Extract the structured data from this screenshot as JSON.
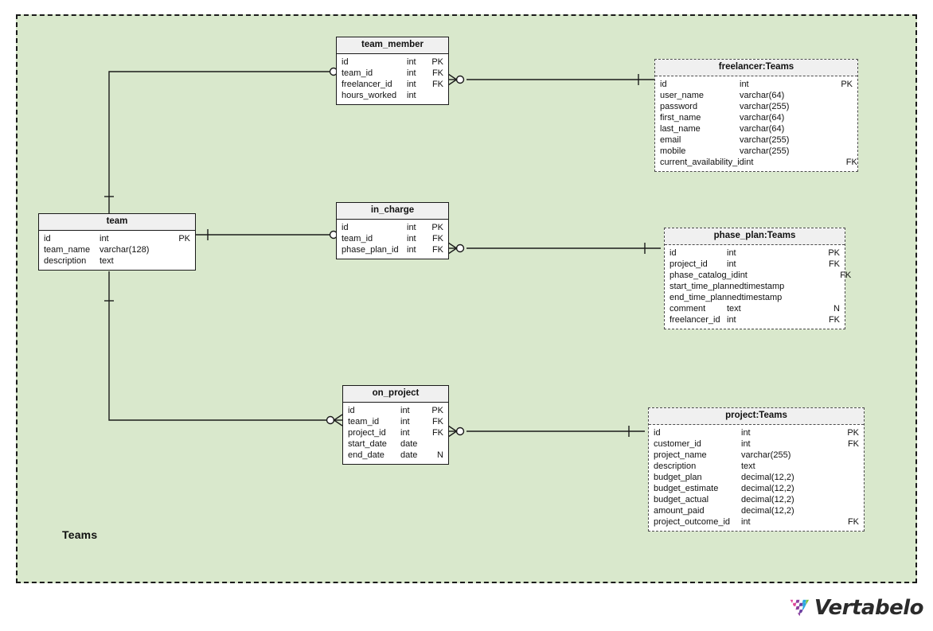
{
  "diagram": {
    "subject_area_label": "Teams",
    "background_color": "#d9e8cc",
    "border_style": "dashed",
    "entity_header_color": "#f0f0f0"
  },
  "entities": {
    "team_member": {
      "title": "team_member",
      "attributes": [
        {
          "name": "id",
          "type": "int",
          "key": "PK"
        },
        {
          "name": "team_id",
          "type": "int",
          "key": "FK"
        },
        {
          "name": "freelancer_id",
          "type": "int",
          "key": "FK"
        },
        {
          "name": "hours_worked",
          "type": "int",
          "key": ""
        }
      ]
    },
    "freelancer": {
      "title": "freelancer:Teams",
      "attributes": [
        {
          "name": "id",
          "type": "int",
          "key": "PK"
        },
        {
          "name": "user_name",
          "type": "varchar(64)",
          "key": ""
        },
        {
          "name": "password",
          "type": "varchar(255)",
          "key": ""
        },
        {
          "name": "first_name",
          "type": "varchar(64)",
          "key": ""
        },
        {
          "name": "last_name",
          "type": "varchar(64)",
          "key": ""
        },
        {
          "name": "email",
          "type": "varchar(255)",
          "key": ""
        },
        {
          "name": "mobile",
          "type": "varchar(255)",
          "key": ""
        },
        {
          "name": "current_availability_id",
          "type": "int",
          "key": "FK"
        }
      ]
    },
    "team": {
      "title": "team",
      "attributes": [
        {
          "name": "id",
          "type": "int",
          "key": "PK"
        },
        {
          "name": "team_name",
          "type": "varchar(128)",
          "key": ""
        },
        {
          "name": "description",
          "type": "text",
          "key": ""
        }
      ]
    },
    "in_charge": {
      "title": "in_charge",
      "attributes": [
        {
          "name": "id",
          "type": "int",
          "key": "PK"
        },
        {
          "name": "team_id",
          "type": "int",
          "key": "FK"
        },
        {
          "name": "phase_plan_id",
          "type": "int",
          "key": "FK"
        }
      ]
    },
    "phase_plan": {
      "title": "phase_plan:Teams",
      "attributes": [
        {
          "name": "id",
          "type": "int",
          "key": "PK"
        },
        {
          "name": "project_id",
          "type": "int",
          "key": "FK"
        },
        {
          "name": "phase_catalog_id",
          "type": "int",
          "key": "FK"
        },
        {
          "name": "start_time_planned",
          "type": "timestamp",
          "key": ""
        },
        {
          "name": "end_time_planned",
          "type": "timestamp",
          "key": ""
        },
        {
          "name": "comment",
          "type": "text",
          "key": "N"
        },
        {
          "name": "freelancer_id",
          "type": "int",
          "key": "FK"
        }
      ]
    },
    "on_project": {
      "title": "on_project",
      "attributes": [
        {
          "name": "id",
          "type": "int",
          "key": "PK"
        },
        {
          "name": "team_id",
          "type": "int",
          "key": "FK"
        },
        {
          "name": "project_id",
          "type": "int",
          "key": "FK"
        },
        {
          "name": "start_date",
          "type": "date",
          "key": ""
        },
        {
          "name": "end_date",
          "type": "date",
          "key": "N"
        }
      ]
    },
    "project": {
      "title": "project:Teams",
      "attributes": [
        {
          "name": "id",
          "type": "int",
          "key": "PK"
        },
        {
          "name": "customer_id",
          "type": "int",
          "key": "FK"
        },
        {
          "name": "project_name",
          "type": "varchar(255)",
          "key": ""
        },
        {
          "name": "description",
          "type": "text",
          "key": ""
        },
        {
          "name": "budget_plan",
          "type": "decimal(12,2)",
          "key": ""
        },
        {
          "name": "budget_estimate",
          "type": "decimal(12,2)",
          "key": ""
        },
        {
          "name": "budget_actual",
          "type": "decimal(12,2)",
          "key": ""
        },
        {
          "name": "amount_paid",
          "type": "decimal(12,2)",
          "key": ""
        },
        {
          "name": "project_outcome_id",
          "type": "int",
          "key": "FK"
        }
      ]
    }
  },
  "relationships": [
    {
      "from": "team",
      "to": "team_member",
      "from_cardinality": "one",
      "to_cardinality": "zero-or-many"
    },
    {
      "from": "freelancer",
      "to": "team_member",
      "from_cardinality": "one",
      "to_cardinality": "zero-or-many"
    },
    {
      "from": "team",
      "to": "in_charge",
      "from_cardinality": "one",
      "to_cardinality": "zero-or-many"
    },
    {
      "from": "phase_plan",
      "to": "in_charge",
      "from_cardinality": "one",
      "to_cardinality": "zero-or-many"
    },
    {
      "from": "team",
      "to": "on_project",
      "from_cardinality": "one",
      "to_cardinality": "zero-or-many"
    },
    {
      "from": "project",
      "to": "on_project",
      "from_cardinality": "one",
      "to_cardinality": "zero-or-many"
    }
  ],
  "logo": {
    "wordmark": "Vertabelo",
    "colors": [
      "#e0489a",
      "#8e3f9e",
      "#6b3fa0",
      "#29a7e1",
      "#7cc242"
    ]
  }
}
